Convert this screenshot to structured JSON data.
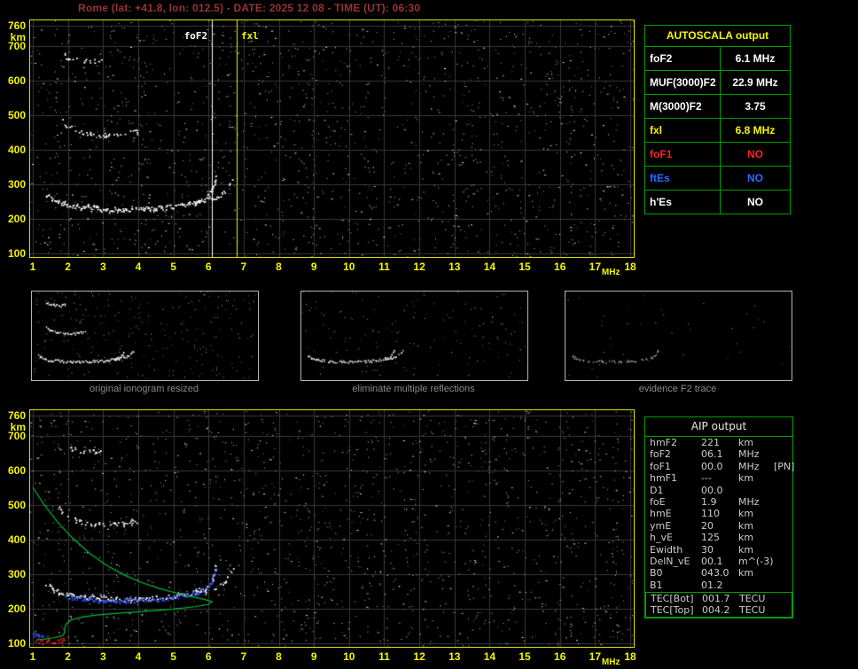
{
  "header": {
    "title": "Rome (lat: +41.8, lon: 012.5) - DATE: 2025 12 08 - TIME (UT): 06:30"
  },
  "autoscala": {
    "title": "AUTOSCALA output",
    "rows": [
      {
        "label": "foF2",
        "value": "6.1 MHz",
        "color": "#ffffff"
      },
      {
        "label": "MUF(3000)F2",
        "value": "22.9 MHz",
        "color": "#ffffff"
      },
      {
        "label": "M(3000)F2",
        "value": "3.75",
        "color": "#ffffff"
      },
      {
        "label": "fxl",
        "value": "6.8 MHz",
        "color": "#f6f600"
      },
      {
        "label": "foF1",
        "value": "NO",
        "color": "#ff2020"
      },
      {
        "label": "ftEs",
        "value": "NO",
        "color": "#2e6bff"
      },
      {
        "label": "h'Es",
        "value": "NO",
        "color": "#ffffff"
      }
    ]
  },
  "aip": {
    "title": "AIP output",
    "rows": [
      {
        "label": "hmF2",
        "value": "221",
        "unit": "km",
        "extra": ""
      },
      {
        "label": "foF2",
        "value": "06.1",
        "unit": "MHz",
        "extra": ""
      },
      {
        "label": "foF1",
        "value": "00.0",
        "unit": "MHz",
        "extra": "[PN]"
      },
      {
        "label": "hmF1",
        "value": "---",
        "unit": "km",
        "extra": ""
      },
      {
        "label": "D1",
        "value": "00.0",
        "unit": "",
        "extra": ""
      },
      {
        "label": "foE",
        "value": "1.9",
        "unit": "MHz",
        "extra": ""
      },
      {
        "label": "hmE",
        "value": "110",
        "unit": "km",
        "extra": ""
      },
      {
        "label": "ymE",
        "value": "20",
        "unit": "km",
        "extra": ""
      },
      {
        "label": "h_vE",
        "value": "125",
        "unit": "km",
        "extra": ""
      },
      {
        "label": "Ewidth",
        "value": "30",
        "unit": "km",
        "extra": ""
      },
      {
        "label": "DelN_vE",
        "value": "00.1",
        "unit": "m^(-3)",
        "extra": ""
      },
      {
        "label": "B0",
        "value": "043.0",
        "unit": "km",
        "extra": ""
      },
      {
        "label": "B1",
        "value": "01.2",
        "unit": "",
        "extra": ""
      }
    ],
    "tec_rows": [
      {
        "label": "TEC[Bot]",
        "value": "001.7",
        "unit": "TECU",
        "extra": ""
      },
      {
        "label": "TEC[Top]",
        "value": "004.2",
        "unit": "TECU",
        "extra": ""
      }
    ]
  },
  "thumbnails": [
    {
      "caption": "original ionogram resized",
      "series": [
        "F-trace-o",
        "F-trace-x",
        "second-hop",
        "third-hop"
      ],
      "noise": 260,
      "density": 0.9,
      "color": "#f0f0f0"
    },
    {
      "caption": "eliminate multiple reflections",
      "series": [
        "F-trace-o",
        "F-trace-x"
      ],
      "noise": 150,
      "density": 0.85,
      "color": "#e0e0e0"
    },
    {
      "caption": "evidence F2 trace",
      "series": [
        "F-trace-o"
      ],
      "noise": 40,
      "density": 0.5,
      "color": "#9a9a9a"
    }
  ],
  "chart_data": [
    {
      "name": "scaled-ionogram",
      "type": "scatter",
      "xlabel": "MHz",
      "ylabel": "km",
      "xlim": [
        1,
        18
      ],
      "ylim": [
        100,
        760
      ],
      "x_ticks": [
        1,
        2,
        3,
        4,
        5,
        6,
        7,
        8,
        9,
        10,
        11,
        12,
        13,
        14,
        15,
        16,
        17,
        18
      ],
      "y_ticks": [
        760,
        700,
        600,
        500,
        400,
        300,
        200,
        100
      ],
      "grid": true,
      "noise": {
        "count": 1500,
        "seed": 11
      },
      "series": [
        {
          "name": "F-trace-o",
          "type": "dots",
          "color": "#ffffff",
          "density": 0.92,
          "points": [
            [
              1.35,
              272
            ],
            [
              1.6,
              254
            ],
            [
              1.9,
              243
            ],
            [
              2.3,
              236
            ],
            [
              2.9,
              231
            ],
            [
              3.5,
              229
            ],
            [
              4.1,
              230
            ],
            [
              4.6,
              233
            ],
            [
              5.0,
              237
            ],
            [
              5.4,
              244
            ],
            [
              5.7,
              253
            ],
            [
              5.9,
              263
            ],
            [
              6.05,
              280
            ],
            [
              6.15,
              302
            ],
            [
              6.2,
              326
            ]
          ]
        },
        {
          "name": "F-trace-x",
          "type": "dots",
          "color": "#ffffff",
          "density": 0.45,
          "points": [
            [
              5.6,
              246
            ],
            [
              5.9,
              252
            ],
            [
              6.2,
              262
            ],
            [
              6.45,
              278
            ],
            [
              6.6,
              298
            ],
            [
              6.7,
              320
            ]
          ]
        },
        {
          "name": "second-hop",
          "type": "dots",
          "color": "#ffffff",
          "density": 0.55,
          "points": [
            [
              1.75,
              495
            ],
            [
              1.95,
              472
            ],
            [
              2.2,
              458
            ],
            [
              2.5,
              450
            ],
            [
              2.9,
              445
            ],
            [
              3.3,
              444
            ],
            [
              3.7,
              448
            ],
            [
              4.0,
              456
            ]
          ]
        },
        {
          "name": "third-hop",
          "type": "dots",
          "color": "#ffffff",
          "density": 0.5,
          "points": [
            [
              1.8,
              676
            ],
            [
              2.05,
              665
            ],
            [
              2.35,
              659
            ],
            [
              2.65,
              657
            ],
            [
              2.95,
              660
            ]
          ]
        }
      ],
      "vlines": [
        {
          "name": "foF2-line",
          "x": 6.1,
          "color": "#ffffff",
          "label": "foF2",
          "label_side": "left"
        },
        {
          "name": "fxl-line",
          "x": 6.8,
          "color": "#f6f600",
          "label": "fxl",
          "label_side": "right"
        }
      ]
    },
    {
      "name": "aip-ionogram",
      "type": "scatter",
      "xlabel": "MHz",
      "ylabel": "km",
      "xlim": [
        1,
        18
      ],
      "ylim": [
        100,
        760
      ],
      "x_ticks": [
        1,
        2,
        3,
        4,
        5,
        6,
        7,
        8,
        9,
        10,
        11,
        12,
        13,
        14,
        15,
        16,
        17,
        18
      ],
      "y_ticks": [
        760,
        700,
        600,
        500,
        400,
        300,
        200,
        100
      ],
      "grid": true,
      "noise": {
        "count": 1500,
        "seed": 23
      },
      "series": [
        {
          "name": "F-trace-o",
          "type": "dots",
          "color": "#ffffff",
          "density": 0.92,
          "points": [
            [
              1.35,
              272
            ],
            [
              1.6,
              254
            ],
            [
              1.9,
              243
            ],
            [
              2.3,
              236
            ],
            [
              2.9,
              231
            ],
            [
              3.5,
              229
            ],
            [
              4.1,
              230
            ],
            [
              4.6,
              233
            ],
            [
              5.0,
              237
            ],
            [
              5.4,
              244
            ],
            [
              5.7,
              253
            ],
            [
              5.9,
              263
            ],
            [
              6.05,
              280
            ],
            [
              6.15,
              302
            ],
            [
              6.2,
              326
            ]
          ]
        },
        {
          "name": "F-trace-x",
          "type": "dots",
          "color": "#ffffff",
          "density": 0.45,
          "points": [
            [
              5.6,
              246
            ],
            [
              5.9,
              252
            ],
            [
              6.2,
              262
            ],
            [
              6.45,
              278
            ],
            [
              6.6,
              298
            ],
            [
              6.7,
              320
            ]
          ]
        },
        {
          "name": "second-hop",
          "type": "dots",
          "color": "#ffffff",
          "density": 0.55,
          "points": [
            [
              1.75,
              495
            ],
            [
              1.95,
              472
            ],
            [
              2.2,
              458
            ],
            [
              2.5,
              450
            ],
            [
              2.9,
              445
            ],
            [
              3.3,
              444
            ],
            [
              3.7,
              448
            ],
            [
              4.0,
              456
            ]
          ]
        },
        {
          "name": "third-hop",
          "type": "dots",
          "color": "#ffffff",
          "density": 0.5,
          "points": [
            [
              1.8,
              676
            ],
            [
              2.05,
              665
            ],
            [
              2.35,
              659
            ],
            [
              2.65,
              657
            ],
            [
              2.95,
              660
            ]
          ]
        },
        {
          "name": "density-profile",
          "type": "line",
          "color": "#00bb33",
          "points": [
            [
              1.0,
              552
            ],
            [
              1.3,
              505
            ],
            [
              1.7,
              452
            ],
            [
              2.1,
              408
            ],
            [
              2.6,
              362
            ],
            [
              3.1,
              326
            ],
            [
              3.6,
              298
            ],
            [
              4.1,
              276
            ],
            [
              4.6,
              259
            ],
            [
              5.1,
              245
            ],
            [
              5.5,
              236
            ],
            [
              5.9,
              227
            ],
            [
              6.1,
              221
            ],
            [
              6.0,
              213
            ],
            [
              5.6,
              206
            ],
            [
              5.0,
              199
            ],
            [
              4.2,
              193
            ],
            [
              3.4,
              187
            ],
            [
              2.8,
              182
            ],
            [
              2.4,
              176
            ],
            [
              2.1,
              168
            ],
            [
              1.95,
              156
            ],
            [
              1.9,
              143
            ],
            [
              1.9,
              130
            ],
            [
              1.85,
              122
            ],
            [
              1.6,
              116
            ],
            [
              1.3,
              112
            ],
            [
              1.1,
              110
            ]
          ]
        },
        {
          "name": "restored-trace",
          "type": "dots",
          "color": "#2f55ff",
          "density": 0.95,
          "points": [
            [
              1.9,
              235
            ],
            [
              2.3,
              229
            ],
            [
              2.9,
              225
            ],
            [
              3.5,
              224
            ],
            [
              4.1,
              226
            ],
            [
              4.7,
              230
            ],
            [
              5.1,
              236
            ],
            [
              5.5,
              244
            ],
            [
              5.8,
              254
            ],
            [
              6.0,
              268
            ],
            [
              6.1,
              288
            ],
            [
              6.18,
              314
            ]
          ]
        },
        {
          "name": "E-valley-marker",
          "type": "dots",
          "color": "#2f55ff",
          "density": 0.9,
          "points": [
            [
              1.0,
              124
            ],
            [
              1.15,
              120
            ],
            [
              1.3,
              122
            ]
          ]
        },
        {
          "name": "Es-trace",
          "type": "dots",
          "color": "#ff2020",
          "density": 0.9,
          "points": [
            [
              1.05,
              110
            ],
            [
              1.25,
              106
            ],
            [
              1.5,
              104
            ],
            [
              1.75,
              106
            ],
            [
              1.95,
              112
            ]
          ]
        }
      ],
      "vlines": []
    }
  ]
}
